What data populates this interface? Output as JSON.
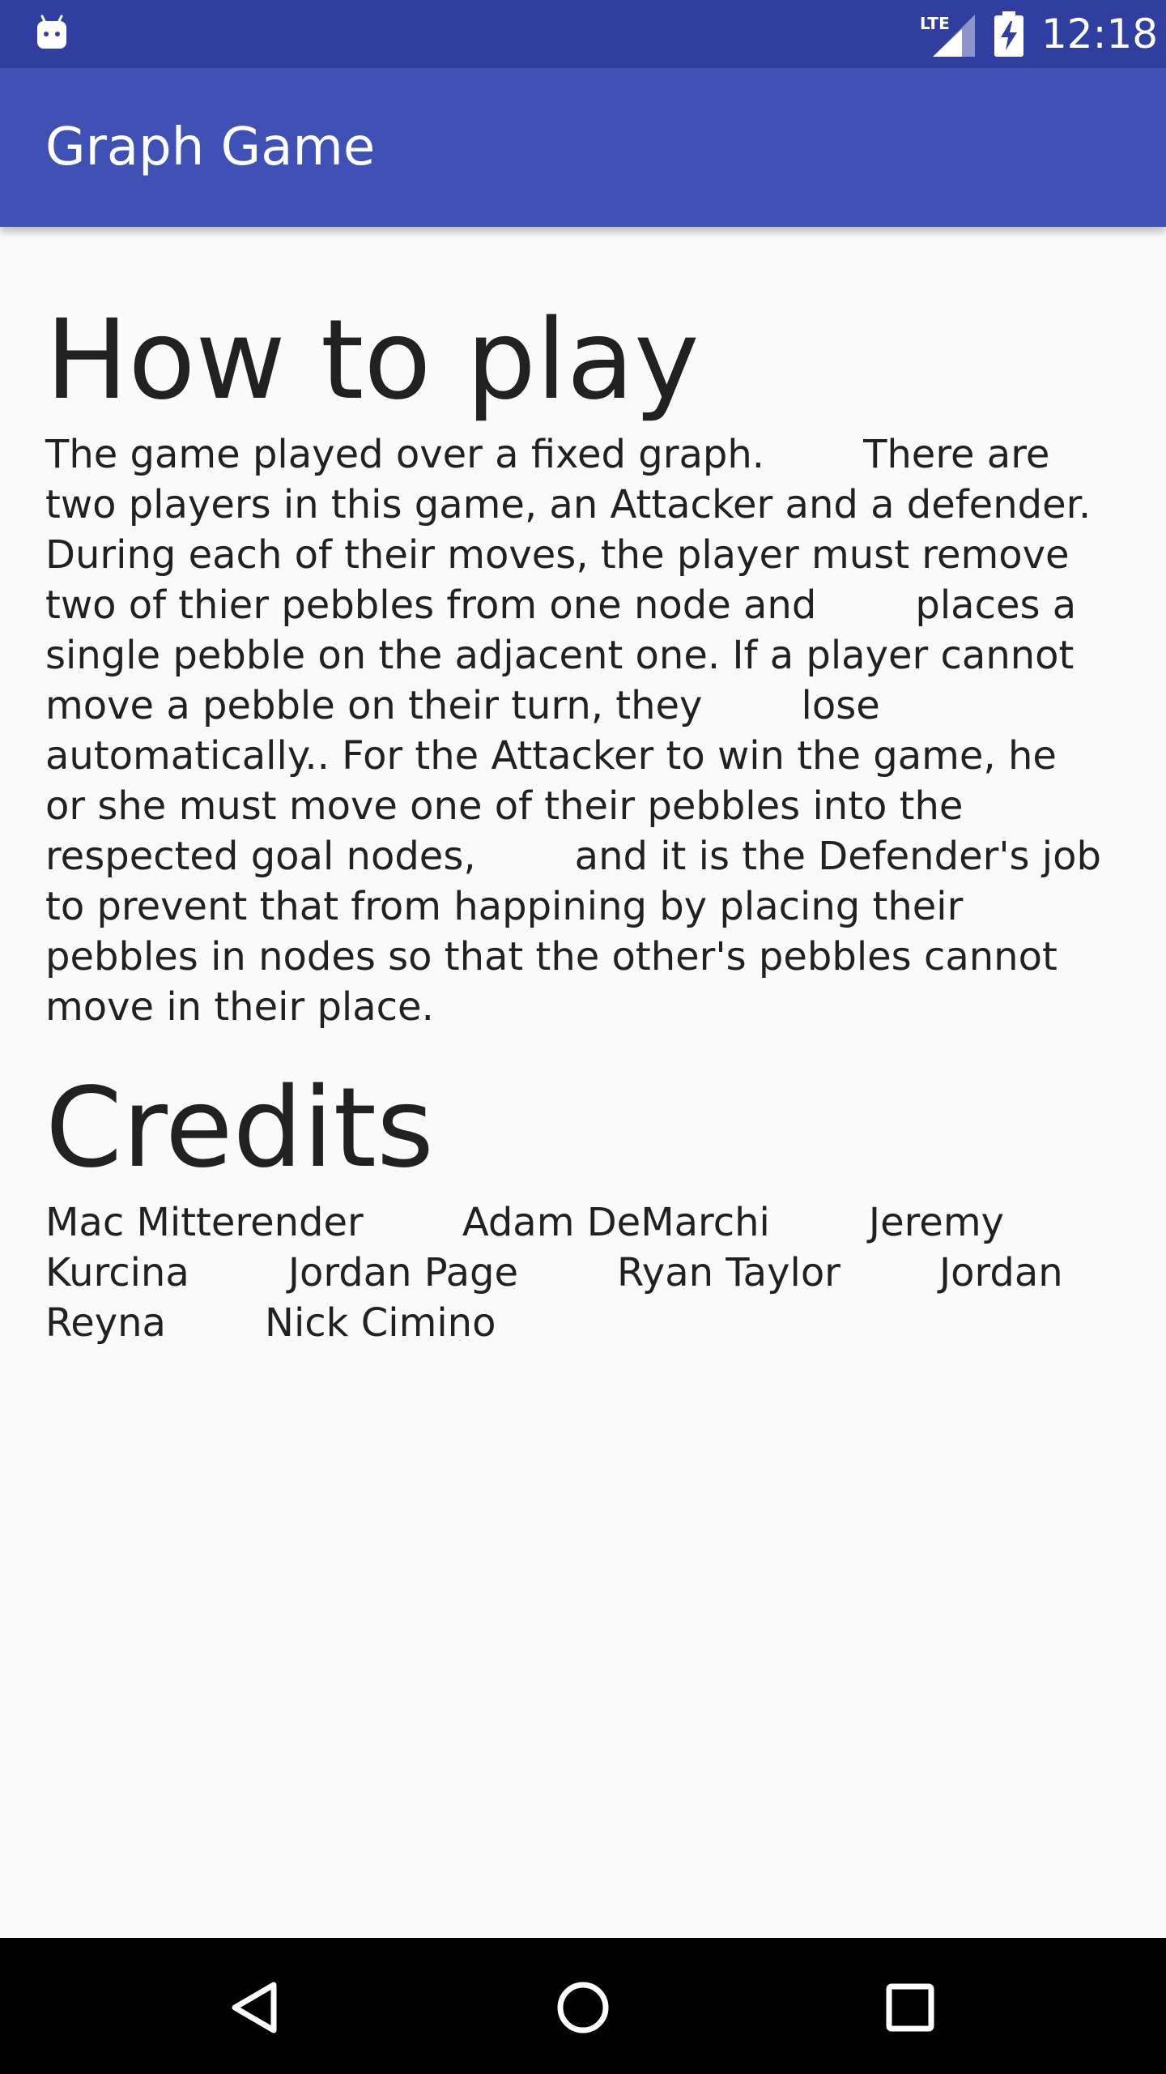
{
  "status_bar": {
    "network_label": "LTE",
    "time": "12:18",
    "icons": [
      "android-debug-icon",
      "lte-signal-icon",
      "battery-charging-icon"
    ]
  },
  "app_bar": {
    "title": "Graph Game"
  },
  "how_to_play": {
    "heading": "How to play",
    "text": "The game played over a fixed graph.        There are two players in this game, an Attacker and a defender. During each of their moves, the player must remove two of thier pebbles from one node and        places a single pebble on the adjacent one. If a player cannot move a pebble on their turn, they        lose automatically.. For the Attacker to win the game, he or she must move one of their pebbles into the respected goal nodes,        and it is the Defender's job to prevent that from happining by placing their pebbles in nodes so that the other's pebbles cannot move in their place."
  },
  "credits": {
    "heading": "Credits",
    "text": "Mac Mitterender        Adam DeMarchi        Jeremy Kurcina        Jordan Page        Ryan Taylor        Jordan Reyna        Nick Cimino"
  },
  "nav_bar": {
    "icons": [
      "back-icon",
      "home-icon",
      "recents-icon"
    ]
  },
  "colors": {
    "status_bar": "#303f9f",
    "app_bar": "#3f51b5",
    "background": "#fafafa",
    "text": "#212121",
    "nav_bar": "#000000"
  }
}
